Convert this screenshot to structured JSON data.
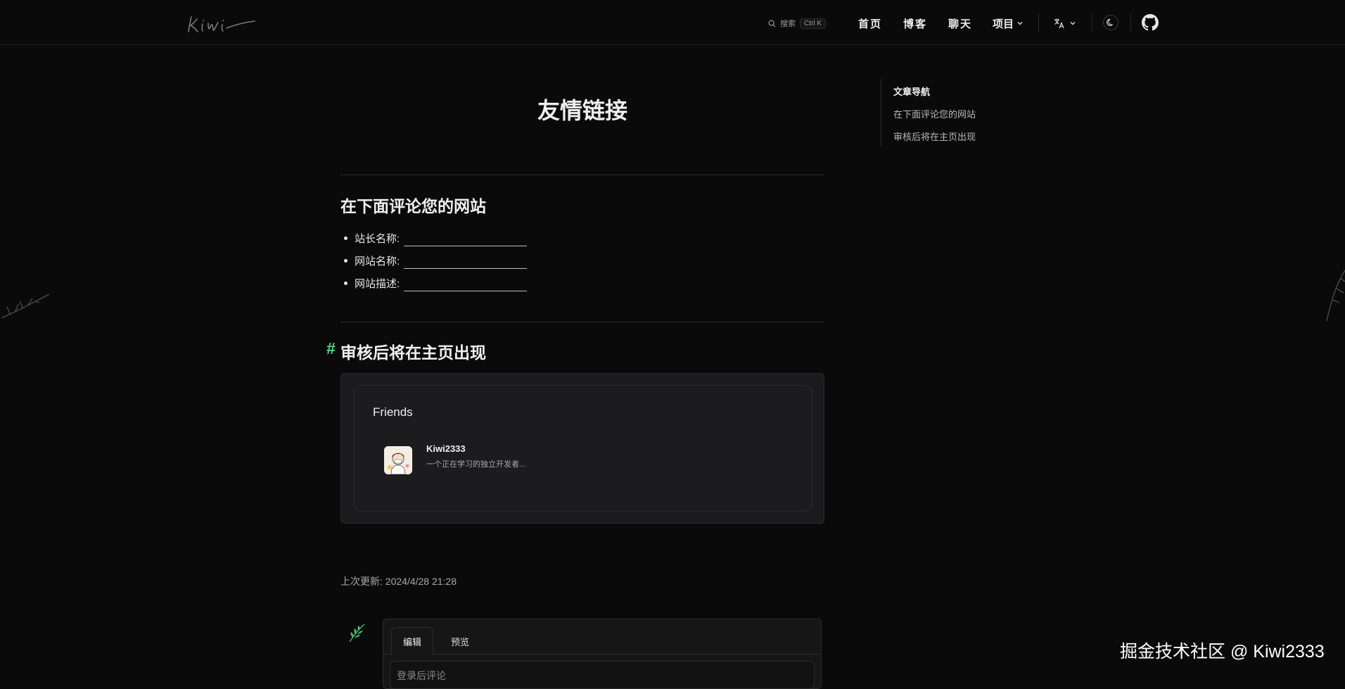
{
  "header": {
    "logo_text": "Kiwi",
    "search": {
      "label": "搜索",
      "shortcut": "Ctrl K"
    },
    "nav": {
      "home": "首页",
      "blog": "博客",
      "chat": "聊天",
      "projects": "项目"
    },
    "icons": {
      "search": "search-icon",
      "language": "translate-icon",
      "theme": "moon-icon",
      "github": "github-icon",
      "chevron": "chevron-down-icon"
    }
  },
  "article": {
    "title": "友情链接",
    "section1": {
      "heading": "在下面评论您的网站",
      "fields": [
        {
          "label": "站长名称:"
        },
        {
          "label": "网站名称:"
        },
        {
          "label": "网站描述:"
        }
      ]
    },
    "section2": {
      "anchor": "#",
      "heading": "审核后将在主页出现"
    },
    "friends_card": {
      "title": "Friends",
      "items": [
        {
          "name": "Kiwi2333",
          "description": "一个正在学习的独立开发者..."
        }
      ]
    },
    "last_updated": "上次更新: 2024/4/28 21:28"
  },
  "comments": {
    "tabs": {
      "edit": "编辑",
      "preview": "预览"
    },
    "input_placeholder": "登录后评论"
  },
  "toc": {
    "title": "文章导航",
    "items": [
      "在下面评论您的网站",
      "审核后将在主页出现"
    ]
  },
  "watermark": "掘金技术社区 @ Kiwi2333",
  "colors": {
    "background": "#0a0a0a",
    "text": "#e6e6e6",
    "anchor_accent": "#4ade80",
    "card_bg": "#1b1b1d"
  }
}
